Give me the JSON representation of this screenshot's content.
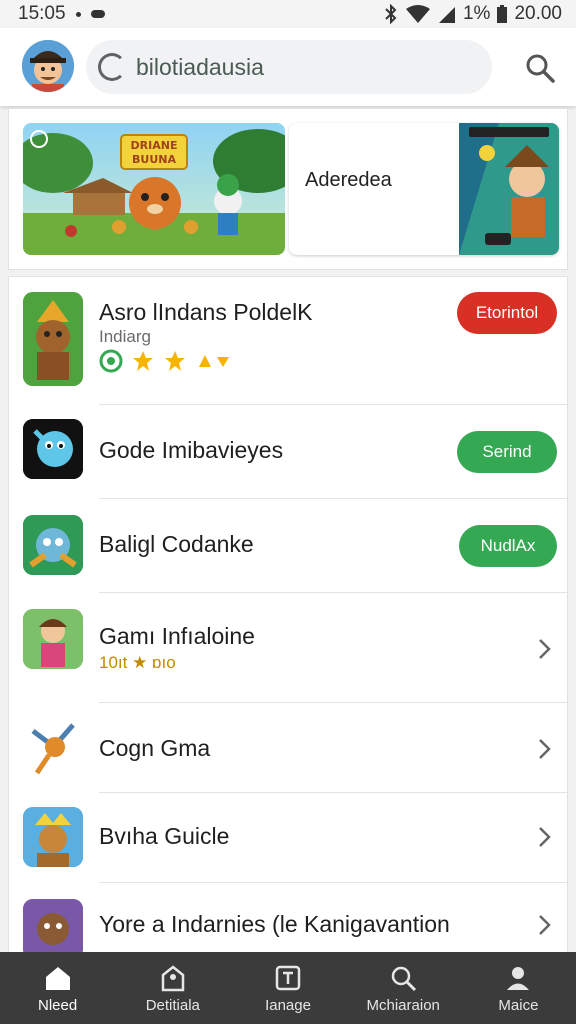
{
  "status": {
    "time": "15:05",
    "battery": "1%",
    "clock_right": "20.00"
  },
  "search": {
    "text": "bilotiadausia"
  },
  "banner": {
    "main_title": "DRIANE BUUNA",
    "side_label": "Aderedea"
  },
  "apps": [
    {
      "title": "Asro lIndans PoldelK",
      "subtitle": "Indiarg",
      "action": "Etorintol",
      "action_color": "#d93025",
      "has_rating": true
    },
    {
      "title": "Gode Imibavieyes",
      "action": "Serind",
      "action_color": "#34a853"
    },
    {
      "title": "Baligl Codanke",
      "action": "NudlAx",
      "action_color": "#34a853"
    },
    {
      "title": "Gamı Infıaloine",
      "subtitle": "10ıt ★ ɒıo",
      "chevron": true
    },
    {
      "title": "Cogn Gma",
      "chevron": true
    },
    {
      "title": "Bvıha Guicle",
      "chevron": true
    },
    {
      "title": "Yore a Indarnies (le Kanigavantion",
      "chevron": true
    }
  ],
  "nav": [
    {
      "label": "Nleed",
      "icon": "home-icon",
      "active": true
    },
    {
      "label": "Detitiala",
      "icon": "tag-icon"
    },
    {
      "label": "Ianage",
      "icon": "manage-icon"
    },
    {
      "label": "Mchiaraion",
      "icon": "search-icon"
    },
    {
      "label": "Maice",
      "icon": "person-icon"
    }
  ],
  "colors": {
    "install_red": "#d93025",
    "install_green": "#34a853",
    "nav_bg": "#3b3b3b"
  }
}
